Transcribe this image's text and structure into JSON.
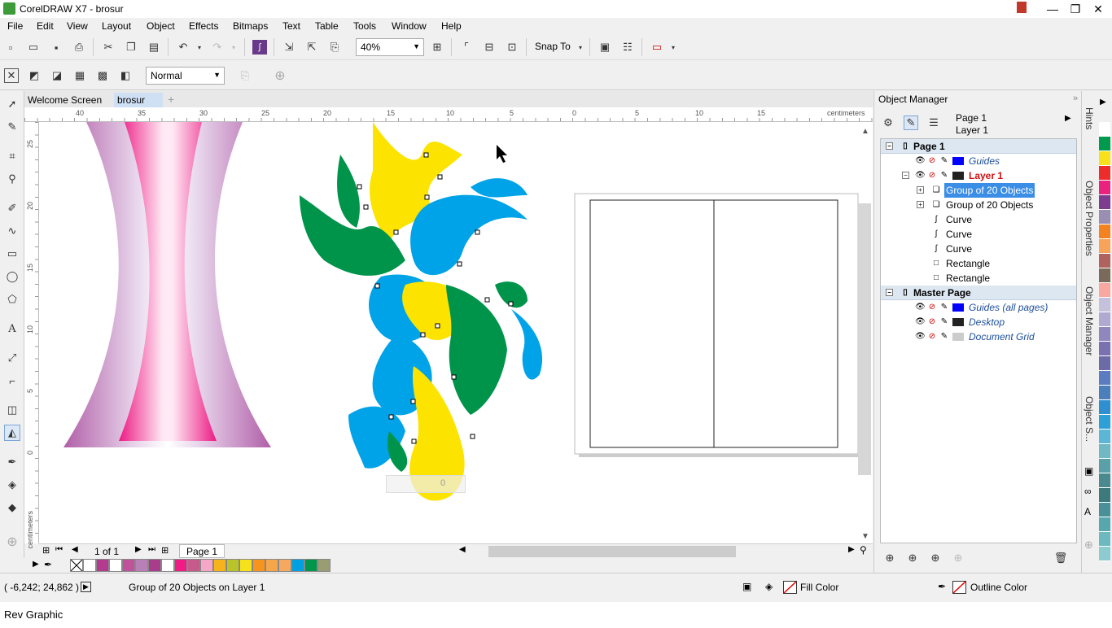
{
  "window": {
    "title": "CorelDRAW X7 - brosur",
    "minimize_glyph": "—",
    "maximize_glyph": "❐",
    "close_glyph": "✕"
  },
  "menu": [
    "File",
    "Edit",
    "View",
    "Layout",
    "Object",
    "Effects",
    "Bitmaps",
    "Text",
    "Table",
    "Tools",
    "Window",
    "Help"
  ],
  "toolbar": {
    "zoom_value": "40%",
    "snap_to_label": "Snap To",
    "blend_mode": "Normal"
  },
  "tabs": {
    "welcome": "Welcome Screen",
    "document": "brosur",
    "add": "+"
  },
  "ruler": {
    "units": "centimeters",
    "h_ticks": [
      "40",
      "35",
      "30",
      "25",
      "20",
      "15",
      "10",
      "5",
      "0",
      "5",
      "10",
      "15",
      "20"
    ],
    "v_ticks": [
      "25",
      "20",
      "15",
      "10",
      "5",
      "0"
    ]
  },
  "canvas": {
    "blend_counter": "0"
  },
  "page_nav": {
    "counter": "1 of 1",
    "page_tab": "Page 1"
  },
  "palette_bottom": [
    "#ffffff",
    "#b23a8f",
    "#ffffff",
    "#c0529b",
    "#b980b8",
    "#a73d8b",
    "#ffffff",
    "#ee1c84",
    "#c65a8a",
    "#f4a7c7",
    "#f7b31b",
    "#b9c42a",
    "#f6e11a",
    "#f7941d",
    "#f5a64a",
    "#f7a85f",
    "#00a0e3",
    "#00964b",
    "#9a9c72"
  ],
  "palette_right": [
    "#ffffff",
    "#009a4e",
    "#f6e11a",
    "#ee2c2c",
    "#e9227f",
    "#7d3c8f",
    "#9b8eb3",
    "#f58220",
    "#f7a35a",
    "#b0625f",
    "#7a6a5c",
    "#f9a8a0",
    "#c5c0dc",
    "#b0aad2",
    "#8f87be",
    "#7a72b0",
    "#6d6aa8",
    "#5b7cc0",
    "#4b7fbb",
    "#2e90d0",
    "#2ea0d8",
    "#5bb6d8",
    "#6fb8c4",
    "#5aa0a8",
    "#4a8a8f",
    "#3d7a7e",
    "#4a9098",
    "#56a8ae",
    "#6cbac0",
    "#8ccbd0"
  ],
  "object_manager": {
    "title": "Object Manager",
    "page_label": "Page 1",
    "layer_label": "Layer 1",
    "rows": [
      {
        "type": "header",
        "label": "Page 1"
      },
      {
        "type": "layer",
        "label": "Guides",
        "color": "#0000ff"
      },
      {
        "type": "layer",
        "label": "Layer 1",
        "color": "#222222",
        "active": true
      },
      {
        "type": "object",
        "label": "Group of 20 Objects",
        "selected": true
      },
      {
        "type": "object",
        "label": "Group of 20 Objects"
      },
      {
        "type": "curve",
        "label": "Curve"
      },
      {
        "type": "curve",
        "label": "Curve"
      },
      {
        "type": "curve",
        "label": "Curve"
      },
      {
        "type": "rect",
        "label": "Rectangle"
      },
      {
        "type": "rect",
        "label": "Rectangle"
      },
      {
        "type": "header",
        "label": "Master Page"
      },
      {
        "type": "layer",
        "label": "Guides (all pages)",
        "color": "#0000ff"
      },
      {
        "type": "layer",
        "label": "Desktop",
        "color": "#222222"
      },
      {
        "type": "layer",
        "label": "Document Grid",
        "color": "#cccccc"
      }
    ]
  },
  "side_tabs": [
    "Hints",
    "Object Properties",
    "Object Manager",
    "Object S..."
  ],
  "status": {
    "coords": "( -6,242; 24,862 )",
    "selection_info": "Group of 20 Objects on Layer 1",
    "fill_label": "Fill Color",
    "outline_label": "Outline Color"
  },
  "taskbar": {
    "label": "Rev Graphic"
  }
}
